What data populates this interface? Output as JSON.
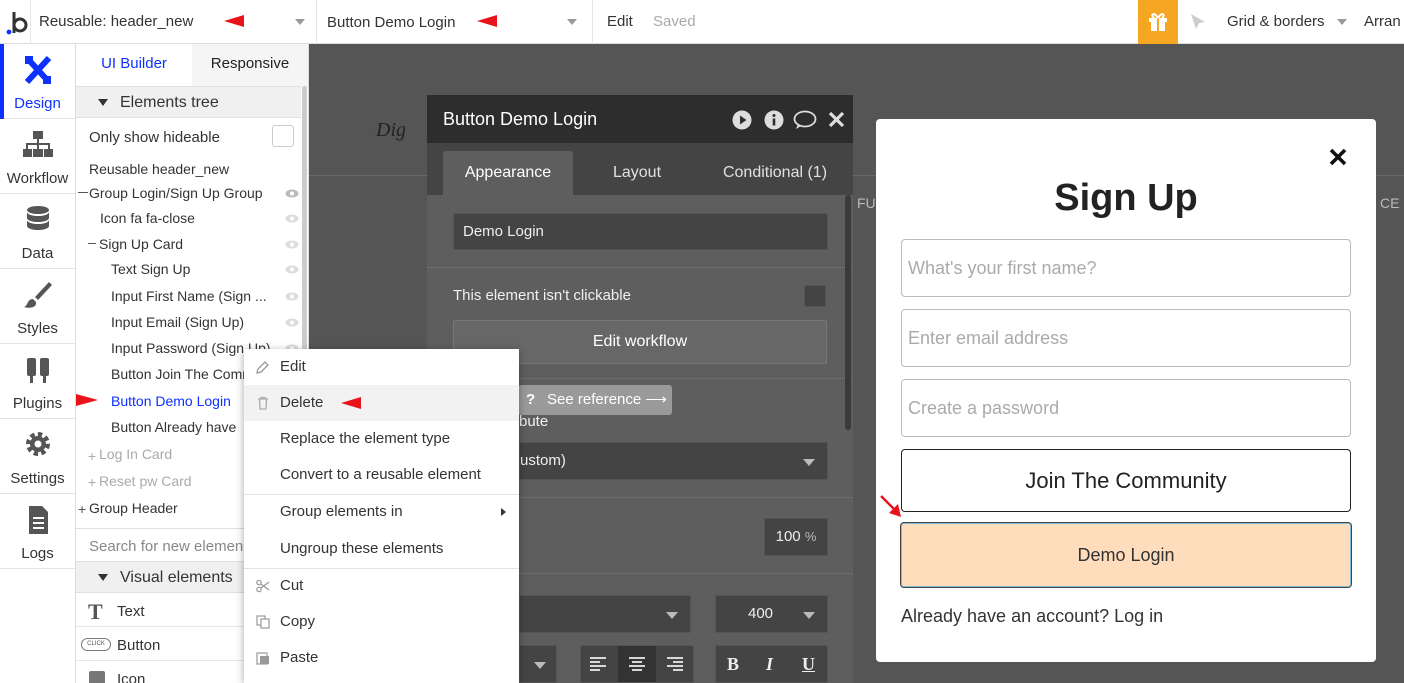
{
  "topbar": {
    "page_selector": "Reusable: header_new",
    "element_selector": "Button Demo Login",
    "edit_label": "Edit",
    "saved_label": "Saved",
    "grid_label": "Grid & borders",
    "user_label": "Arran"
  },
  "nav": {
    "items": [
      {
        "label": "Design",
        "icon": "design-icon",
        "active": true
      },
      {
        "label": "Workflow",
        "icon": "workflow-icon"
      },
      {
        "label": "Data",
        "icon": "database-icon"
      },
      {
        "label": "Styles",
        "icon": "brush-icon"
      },
      {
        "label": "Plugins",
        "icon": "plug-icon"
      },
      {
        "label": "Settings",
        "icon": "gear-icon"
      },
      {
        "label": "Logs",
        "icon": "document-icon"
      }
    ]
  },
  "tree": {
    "tab_ui_builder": "UI Builder",
    "tab_responsive": "Responsive",
    "elements_tree_title": "Elements tree",
    "only_show_hideable": "Only show hideable",
    "rows": [
      "Reusable header_new",
      "Group Login/Sign Up Group",
      "Icon fa fa-close",
      "Sign Up Card",
      "Text Sign Up",
      "Input First Name (Sign ...",
      "Input Email (Sign Up)",
      "Input Password (Sign Up)",
      "Button Join The Comm",
      "Button Demo Login",
      "Button Already have",
      "Log In Card",
      "Reset pw Card",
      "Group Header"
    ],
    "search_placeholder": "Search for new elemen",
    "visual_elements_title": "Visual elements",
    "visual_items": [
      "Text",
      "Button",
      "Icon"
    ],
    "button_icon_text": "CLICK"
  },
  "prop": {
    "title": "Button Demo Login",
    "tabs": [
      "Appearance",
      "Layout",
      "Conditional (1)"
    ],
    "label_value": "Demo Login",
    "not_clickable": "This element isn't clickable",
    "edit_workflow": "Edit workflow",
    "see_reference": "See reference ⟶",
    "attribute_partial": "bute",
    "custom_partial": "ustom)",
    "opacity_value": "100",
    "opacity_unit": "%",
    "font_weight": "400",
    "format_bold": "B",
    "format_italic": "I",
    "format_underline": "U"
  },
  "context_menu": {
    "items": [
      {
        "label": "Edit",
        "icon": "pencil-icon"
      },
      {
        "label": "Delete",
        "icon": "trash-icon"
      },
      {
        "label": "Replace the element type",
        "icon": ""
      },
      {
        "label": "Convert to a reusable element",
        "icon": ""
      },
      {
        "label": "Group elements in",
        "icon": ""
      },
      {
        "label": "Ungroup these elements",
        "icon": ""
      },
      {
        "label": "Cut",
        "icon": "scissors-icon"
      },
      {
        "label": "Copy",
        "icon": "copy-icon"
      },
      {
        "label": "Paste",
        "icon": "paste-icon"
      }
    ]
  },
  "canvas": {
    "logo_partial": "Dig",
    "edge_left": "FU",
    "edge_right": "CE"
  },
  "popup": {
    "title": "Sign Up",
    "first_name_placeholder": "What's your first name?",
    "email_placeholder": "Enter email address",
    "password_placeholder": "Create a password",
    "join_button": "Join The Community",
    "demo_button": "Demo Login",
    "login_link": "Already have an account? Log in"
  },
  "colors": {
    "accent_blue": "#0d30ff",
    "gift_orange": "#f5a623",
    "demo_button_bg": "#ffdcbc",
    "annotation_red": "#e8141b"
  }
}
